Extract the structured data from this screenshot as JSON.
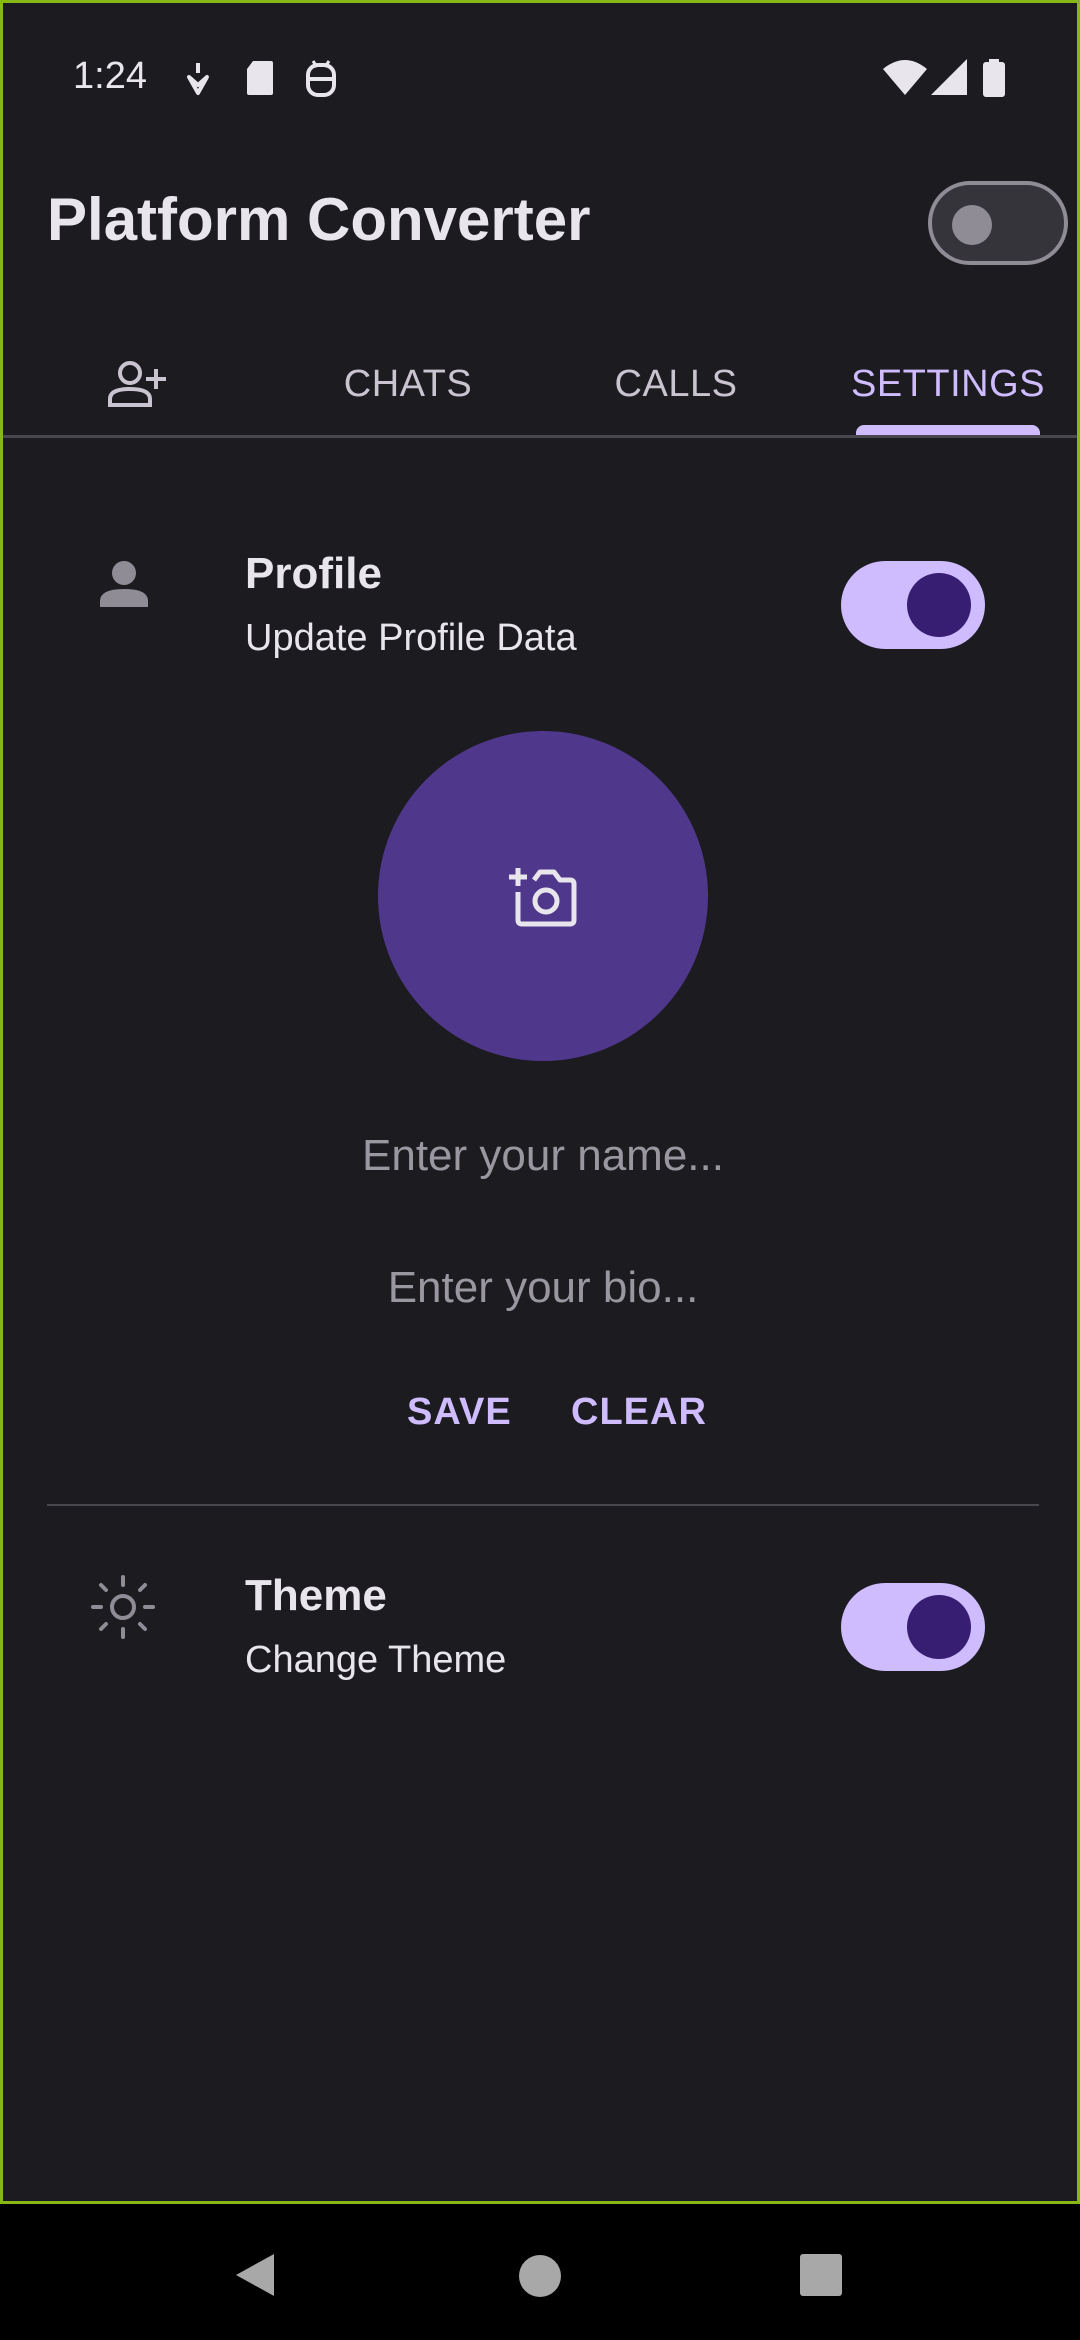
{
  "status_bar": {
    "time": "1:24",
    "icons": [
      "notification-icon",
      "sd-card-icon",
      "robot-icon",
      "wifi-icon",
      "signal-icon",
      "battery-icon"
    ]
  },
  "app_bar": {
    "title": "Platform Converter",
    "platform_toggle_on": false
  },
  "tabs": {
    "items": [
      {
        "label": "",
        "icon": "add-person-icon"
      },
      {
        "label": "CHATS"
      },
      {
        "label": "CALLS"
      },
      {
        "label": "SETTINGS"
      }
    ],
    "active": "SETTINGS"
  },
  "profile": {
    "title": "Profile",
    "subtitle": "Update Profile Data",
    "toggle_on": true,
    "avatar_icon": "add-photo-icon",
    "name_placeholder": "Enter your name...",
    "bio_placeholder": "Enter your bio...",
    "save_label": "SAVE",
    "clear_label": "CLEAR"
  },
  "theme": {
    "title": "Theme",
    "subtitle": "Change Theme",
    "toggle_on": true
  },
  "colors": {
    "background": "#1c1b20",
    "accent": "#cfbcff",
    "avatar": "#4f378b",
    "switch_knob": "#381e72"
  }
}
